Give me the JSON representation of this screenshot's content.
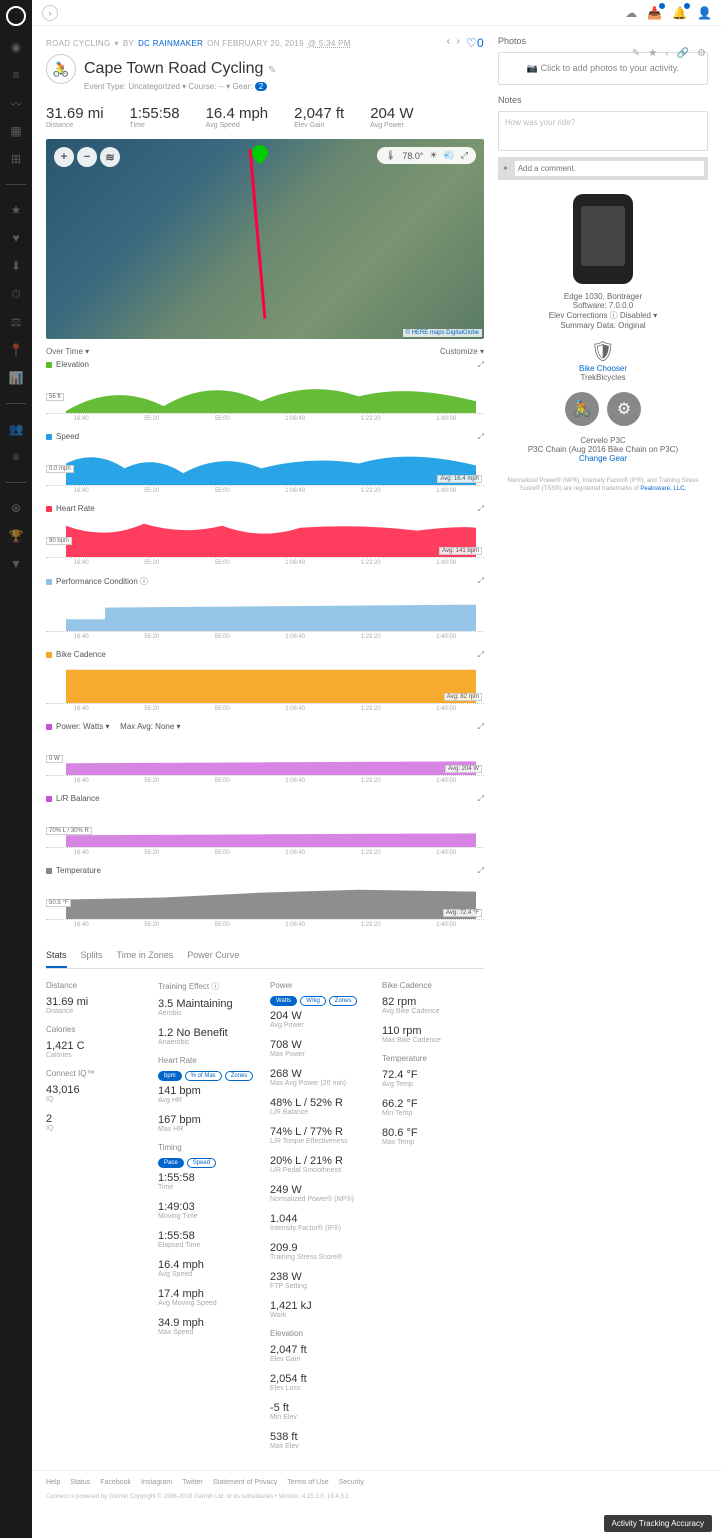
{
  "crumb": {
    "category": "ROAD CYCLING",
    "by": "BY",
    "author": "DC RAINMAKER",
    "on": "ON FEBRUARY 20, 2019",
    "time": "@ 5:34 PM",
    "fav_count": "0"
  },
  "title": "Cape Town Road Cycling",
  "subtitle": {
    "event": "Event Type: Uncategorized ▾",
    "course": "Course: -- ▾",
    "gear_label": "Gear:",
    "gear_badge": "2"
  },
  "summary": [
    {
      "v": "31.69 mi",
      "l": "Distance"
    },
    {
      "v": "1:55:58",
      "l": "Time"
    },
    {
      "v": "16.4 mph",
      "l": "Avg Speed"
    },
    {
      "v": "2,047 ft",
      "l": "Elev Gain"
    },
    {
      "v": "204 W",
      "l": "Avg Power"
    }
  ],
  "map": {
    "temp": "78.0°",
    "attr": "© HERE maps DigitalGlobe"
  },
  "chart_header": {
    "left": "Over Time ▾",
    "right": "Customize ▾"
  },
  "xaxis": [
    "16:40",
    "55:20",
    "55:00",
    "1:06:40",
    "1:23:20",
    "1:40:00"
  ],
  "charts": [
    {
      "title": "Elevation",
      "color": "#5cb82c",
      "ylab": "56 ft",
      "ymax": "750",
      "ymin": "500",
      "avg": ""
    },
    {
      "title": "Speed",
      "color": "#1ea0e6",
      "ylab": "0.0 mph",
      "ymax": "40.0",
      "avg": "Avg: 16.4 mph"
    },
    {
      "title": "Heart Rate",
      "color": "#ff3355",
      "ylab": "90 bpm",
      "ymax": "175",
      "ymid": "150",
      "avg": "Avg: 141 bpm"
    },
    {
      "title": "Performance Condition ⓘ",
      "color": "#8fc3e6",
      "ylab": "",
      "ymax": "10",
      "ymid": "0",
      "ymin": "-10",
      "avg": ""
    },
    {
      "title": "Bike Cadence",
      "color": "#f5a623",
      "ylab": "",
      "ymax": "150",
      "ymid": "100",
      "ymin": "50",
      "avg": "Avg: 82 rpm"
    },
    {
      "title": "Power: Watts ▾",
      "subtitle": "Max Avg: None ▾",
      "color": "#c850d8",
      "ylab": "0 W",
      "avg": "Avg: 204 W"
    },
    {
      "title": "L/R Balance",
      "color": "#c850d8",
      "ylab": "70% L / 30% R",
      "ymax": "100% L",
      "ymin": "100% R",
      "avg": ""
    },
    {
      "title": "Temperature",
      "color": "#888",
      "ylab": "50.5 °F",
      "ymax": "90.0",
      "ymid": "45.0",
      "avg": "Avg: 72.4 °F"
    }
  ],
  "tabs": [
    "Stats",
    "Splits",
    "Time in Zones",
    "Power Curve"
  ],
  "stats": {
    "col1": [
      {
        "h": "Distance",
        "items": [
          {
            "v": "31.69 mi",
            "l": "Distance"
          }
        ]
      },
      {
        "h": "Calories",
        "items": [
          {
            "v": "1,421 C",
            "l": "Calories"
          }
        ]
      },
      {
        "h": "Connect IQ™",
        "items": [
          {
            "v": "43,016",
            "l": "IQ"
          },
          {
            "v": "2",
            "l": "IQ"
          }
        ]
      }
    ],
    "col2": [
      {
        "h": "Training Effect ⓘ",
        "items": [
          {
            "v": "3.5 Maintaining",
            "l": "Aerobic"
          },
          {
            "v": "1.2 No Benefit",
            "l": "Anaerobic"
          }
        ]
      },
      {
        "h": "Heart Rate",
        "pills": [
          "bpm",
          "% of Max",
          "Zones"
        ],
        "items": [
          {
            "v": "141 bpm",
            "l": "Avg HR"
          },
          {
            "v": "167 bpm",
            "l": "Max HR"
          }
        ]
      },
      {
        "h": "Timing",
        "pills": [
          "Pace",
          "Speed"
        ],
        "items": [
          {
            "v": "1:55:58",
            "l": "Time"
          },
          {
            "v": "1:49:03",
            "l": "Moving Time"
          },
          {
            "v": "1:55:58",
            "l": "Elapsed Time"
          },
          {
            "v": "16.4 mph",
            "l": "Avg Speed"
          },
          {
            "v": "17.4 mph",
            "l": "Avg Moving Speed"
          },
          {
            "v": "34.9 mph",
            "l": "Max Speed"
          }
        ]
      }
    ],
    "col3": [
      {
        "h": "Power",
        "pills": [
          "Watts",
          "W/kg",
          "Zones"
        ],
        "items": [
          {
            "v": "204 W",
            "l": "Avg Power"
          },
          {
            "v": "708 W",
            "l": "Max Power"
          },
          {
            "v": "268 W",
            "l": "Max Avg Power (20 min)"
          },
          {
            "v": "48% L / 52% R",
            "l": "L/R Balance"
          },
          {
            "v": "74% L / 77% R",
            "l": "L/R Torque Effectiveness"
          },
          {
            "v": "20% L / 21% R",
            "l": "L/R Pedal Smoothness"
          },
          {
            "v": "249 W",
            "l": "Normalized Power® (NP®)"
          },
          {
            "v": "1.044",
            "l": "Intensity Factor® (IF®)"
          },
          {
            "v": "209.9",
            "l": "Training Stress Score®"
          },
          {
            "v": "238 W",
            "l": "FTP Setting"
          },
          {
            "v": "1,421 kJ",
            "l": "Work"
          }
        ]
      },
      {
        "h": "Elevation",
        "items": [
          {
            "v": "2,047 ft",
            "l": "Elev Gain"
          },
          {
            "v": "2,054 ft",
            "l": "Elev Loss"
          },
          {
            "v": "-5 ft",
            "l": "Min Elev"
          },
          {
            "v": "538 ft",
            "l": "Max Elev"
          }
        ]
      }
    ],
    "col4": [
      {
        "h": "Bike Cadence",
        "items": [
          {
            "v": "82 rpm",
            "l": "Avg Bike Cadence"
          },
          {
            "v": "110 rpm",
            "l": "Max Bike Cadence"
          }
        ]
      },
      {
        "h": "Temperature",
        "items": [
          {
            "v": "72.4 °F",
            "l": "Avg Temp"
          },
          {
            "v": "66.2 °F",
            "l": "Min Temp"
          },
          {
            "v": "80.6 °F",
            "l": "Max Temp"
          }
        ]
      }
    ]
  },
  "photos": {
    "title": "Photos",
    "add": "Click to add photos to your activity."
  },
  "notes": {
    "title": "Notes",
    "placeholder": "How was your ride?",
    "comment": "Add a comment."
  },
  "device": {
    "name": "Edge 1030, Bontrager",
    "sw": "Software: 7.0.0.0",
    "elev": "Elev Corrections ⓘ Disabled ▾",
    "summary": "Summary Data: Original",
    "chooser": "Bike Chooser",
    "brand": "TrekBicycles"
  },
  "gear": {
    "name": "Cervelo P3C",
    "chain": "P3C Chain (Aug 2016 Bike Chain on P3C)",
    "change": "Change Gear"
  },
  "legal": "Normalized Power® (NP®), Intensity Factor® (IF®), and Training Stress Score® (TSS®) are registered trademarks of ",
  "legal_link": "Peaksware, LLC.",
  "footer": {
    "links": [
      "Help",
      "Status",
      "Facebook",
      "Instagram",
      "Twitter",
      "Statement of Privacy",
      "Terms of Use",
      "Security"
    ],
    "copy": "Connect is powered by Garmin    Copyright © 1996-2019 Garmin Ltd. or its subsidiaries • Version: 4.15.2.0, 19.4.3.2"
  },
  "tracking_btn": "Activity Tracking Accuracy",
  "chart_data": {
    "type": "line",
    "note": "Eight stacked time-series charts over ride duration ~1:55:58. X-axis ticks at 16:40, 55:20, 55:00, 1:06:40, 1:23:20, 1:40:00.",
    "series": [
      {
        "name": "Elevation",
        "unit": "ft",
        "range": [
          0,
          750
        ],
        "current": 56
      },
      {
        "name": "Speed",
        "unit": "mph",
        "range": [
          0,
          40
        ],
        "avg": 16.4,
        "current": 0.0
      },
      {
        "name": "Heart Rate",
        "unit": "bpm",
        "range": [
          90,
          175
        ],
        "avg": 141,
        "current": 90
      },
      {
        "name": "Performance Condition",
        "unit": "",
        "range": [
          -10,
          10
        ]
      },
      {
        "name": "Bike Cadence",
        "unit": "rpm",
        "range": [
          0,
          150
        ],
        "avg": 82
      },
      {
        "name": "Power",
        "unit": "W",
        "range": [
          0,
          1000
        ],
        "avg": 204,
        "current": 0
      },
      {
        "name": "L/R Balance",
        "unit": "%",
        "current": "70L/30R"
      },
      {
        "name": "Temperature",
        "unit": "°F",
        "range": [
          14,
          90
        ],
        "avg": 72.4,
        "current": 50.5
      }
    ]
  }
}
